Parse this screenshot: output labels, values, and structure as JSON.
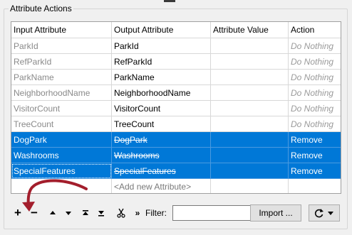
{
  "group": {
    "title": "Attribute Actions"
  },
  "table": {
    "columns": [
      "Input Attribute",
      "Output Attribute",
      "Attribute Value",
      "Action"
    ],
    "rows": [
      {
        "input": "ParkId",
        "output": "ParkId",
        "value": "",
        "action": "Do Nothing",
        "selected": false
      },
      {
        "input": "RefParkId",
        "output": "RefParkId",
        "value": "",
        "action": "Do Nothing",
        "selected": false
      },
      {
        "input": "ParkName",
        "output": "ParkName",
        "value": "",
        "action": "Do Nothing",
        "selected": false
      },
      {
        "input": "NeighborhoodName",
        "output": "NeighborhoodName",
        "value": "",
        "action": "Do Nothing",
        "selected": false
      },
      {
        "input": "VisitorCount",
        "output": "VisitorCount",
        "value": "",
        "action": "Do Nothing",
        "selected": false
      },
      {
        "input": "TreeCount",
        "output": "TreeCount",
        "value": "",
        "action": "Do Nothing",
        "selected": false
      },
      {
        "input": "DogPark",
        "output": "DogPark",
        "value": "",
        "action": "Remove",
        "selected": true
      },
      {
        "input": "Washrooms",
        "output": "Washrooms",
        "value": "",
        "action": "Remove",
        "selected": true
      },
      {
        "input": "SpecialFeatures",
        "output": "SpecialFeatures",
        "value": "",
        "action": "Remove",
        "selected": true
      }
    ],
    "add_new": "<Add new Attribute>"
  },
  "toolbar": {
    "add": "+",
    "remove": "−",
    "filter_label": "Filter:",
    "filter_value": "",
    "import_label": "Import ...",
    "reset_icon": "refresh-icon"
  },
  "colors": {
    "selection": "#0078d7",
    "annotation_arrow": "#a31e2c"
  }
}
